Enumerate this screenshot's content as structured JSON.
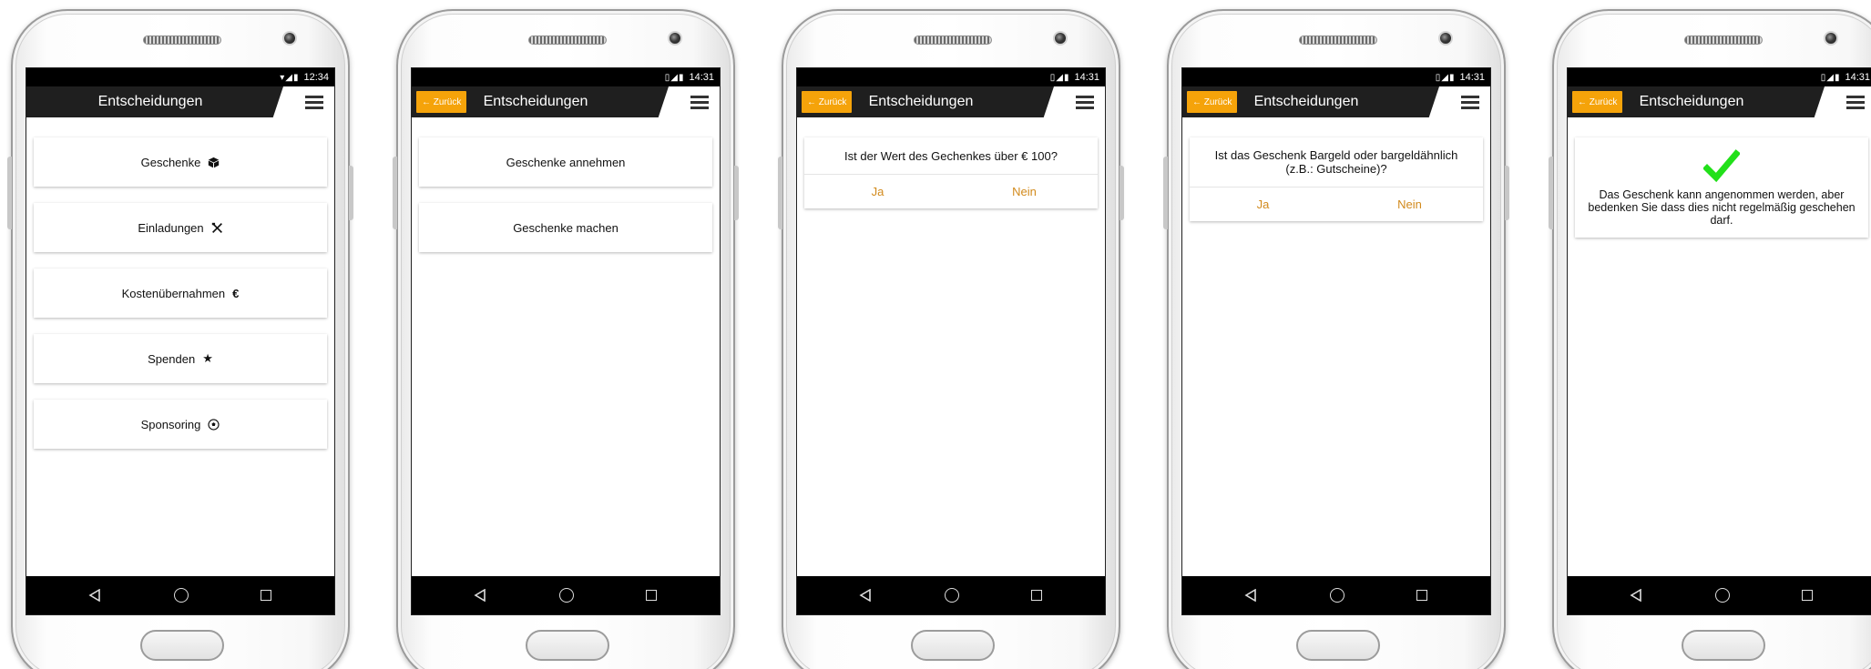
{
  "status_times": [
    "12:34",
    "14:31",
    "14:31",
    "14:31",
    "14:31"
  ],
  "appbar": {
    "title": "Entscheidungen",
    "back_label": "← Zurück"
  },
  "screen1": {
    "items": [
      {
        "label": "Geschenke",
        "icon": "package-icon",
        "glyph": "📦"
      },
      {
        "label": "Einladungen",
        "icon": "cutlery-icon",
        "glyph": "✕"
      },
      {
        "label": "Kostenübernahmen",
        "icon": "euro-icon",
        "glyph": "€"
      },
      {
        "label": "Spenden",
        "icon": "star-icon",
        "glyph": "★"
      },
      {
        "label": "Sponsoring",
        "icon": "soccer-ball-icon",
        "glyph": "⚽"
      }
    ]
  },
  "screen2": {
    "items": [
      "Geschenke annehmen",
      "Geschenke machen"
    ]
  },
  "screen3": {
    "question": "Ist der Wert des Gechenkes über € 100?",
    "yes": "Ja",
    "no": "Nein"
  },
  "screen4": {
    "question": "Ist das Geschenk Bargeld oder bargeldähnlich (z.B.: Gutscheine)?",
    "yes": "Ja",
    "no": "Nein"
  },
  "screen5": {
    "result": "Das Geschenk kann angenommen werden, aber bedenken Sie dass dies nicht regelmäßig geschehen darf.",
    "check_color": "#22e01a"
  },
  "colors": {
    "accent": "#f5a30a",
    "answer_text": "#d28a1c",
    "appbar": "#1f1f1f"
  }
}
